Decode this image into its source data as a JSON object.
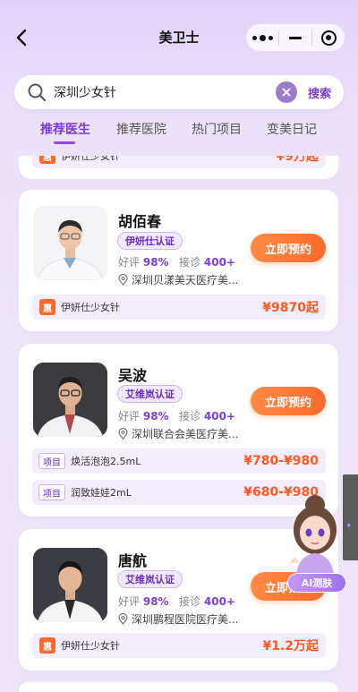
{
  "nav": {
    "title": "美卫士"
  },
  "search": {
    "query": "深圳少女针",
    "button": "搜索"
  },
  "tabs": [
    {
      "label": "推荐医生"
    },
    {
      "label": "推荐医院"
    },
    {
      "label": "热门项目"
    },
    {
      "label": "变美日记"
    }
  ],
  "partial_card": {
    "product": "伊妍仕少女针",
    "price": "¥9万起"
  },
  "doctors": [
    {
      "name": "胡佰春",
      "cert": "伊妍仕认证",
      "good_label": "好评",
      "good_rate": "98%",
      "visit_label": "接诊",
      "visits": "400+",
      "location": "深圳贝漾美天医疗美...",
      "book": "立即预约",
      "products": [
        {
          "badge": "惠",
          "name": "伊妍仕少女针",
          "price": "¥9870起"
        }
      ]
    },
    {
      "name": "吴波",
      "cert": "艾维岚认证",
      "good_label": "好评",
      "good_rate": "98%",
      "visit_label": "接诊",
      "visits": "400+",
      "location": "深圳联合会美医疗美...",
      "book": "立即预约",
      "products": [
        {
          "tag": "项目",
          "name": "焕活泡泡2.5mL",
          "price": "¥780-¥980"
        },
        {
          "tag": "项目",
          "name": "润致娃娃2mL",
          "price": "¥680-¥980"
        }
      ]
    },
    {
      "name": "唐航",
      "cert": "艾维岚认证",
      "good_label": "好评",
      "good_rate": "98%",
      "visit_label": "接诊",
      "visits": "400+",
      "location": "深圳鹏程医院医疗美...",
      "book": "立即预约",
      "products": [
        {
          "badge": "惠",
          "name": "伊妍仕少女针",
          "price": "¥1.2万起"
        }
      ]
    }
  ],
  "ai_button": {
    "label": "AI测肤"
  },
  "colors": {
    "accent": "#7b3fd6",
    "price": "#ff5a1f",
    "button": "#ff7a3a"
  }
}
